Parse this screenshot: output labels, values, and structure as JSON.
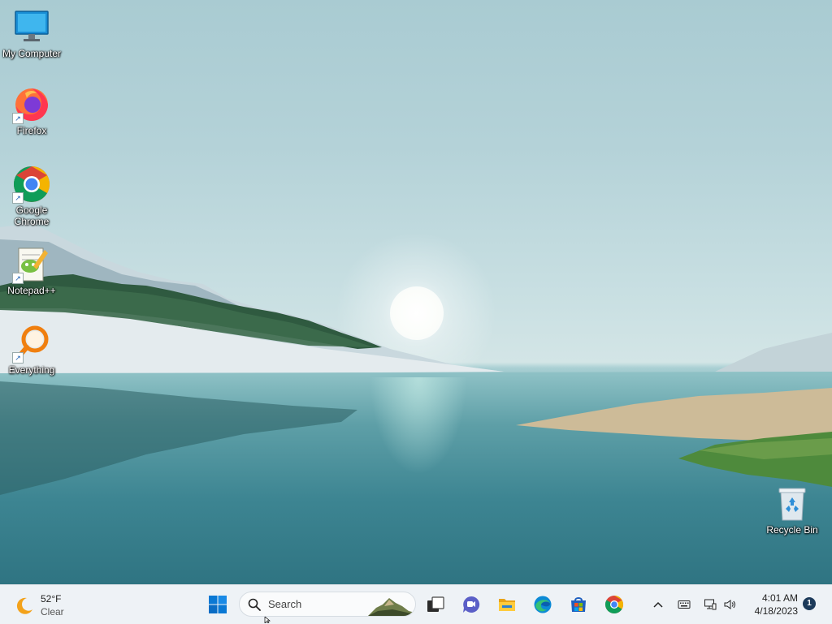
{
  "desktop": {
    "icons": [
      {
        "label": "My Computer",
        "icon": "computer-icon"
      },
      {
        "label": "Firefox",
        "icon": "firefox-icon"
      },
      {
        "label": "Google Chrome",
        "icon": "chrome-icon"
      },
      {
        "label": "Notepad++",
        "icon": "notepadpp-icon"
      },
      {
        "label": "Everything",
        "icon": "everything-search-icon"
      },
      {
        "label": "Recycle Bin",
        "icon": "recycle-bin-icon"
      }
    ]
  },
  "taskbar": {
    "weather": {
      "temp": "52°F",
      "condition": "Clear",
      "icon": "moon-icon"
    },
    "search": {
      "placeholder": "Search"
    },
    "pinned": [
      {
        "name": "start",
        "icon": "windows-start-icon"
      },
      {
        "name": "task-view",
        "icon": "task-view-icon"
      },
      {
        "name": "chat",
        "icon": "teams-chat-icon"
      },
      {
        "name": "file-explorer",
        "icon": "folder-icon"
      },
      {
        "name": "edge",
        "icon": "edge-icon"
      },
      {
        "name": "store",
        "icon": "store-icon"
      },
      {
        "name": "chrome",
        "icon": "chrome-icon"
      }
    ],
    "tray": {
      "time": "4:01 AM",
      "date": "4/18/2023",
      "notification_count": "1"
    }
  },
  "colors": {
    "taskbar_bg": "#eef2f6",
    "accent": "#0a64c8"
  }
}
